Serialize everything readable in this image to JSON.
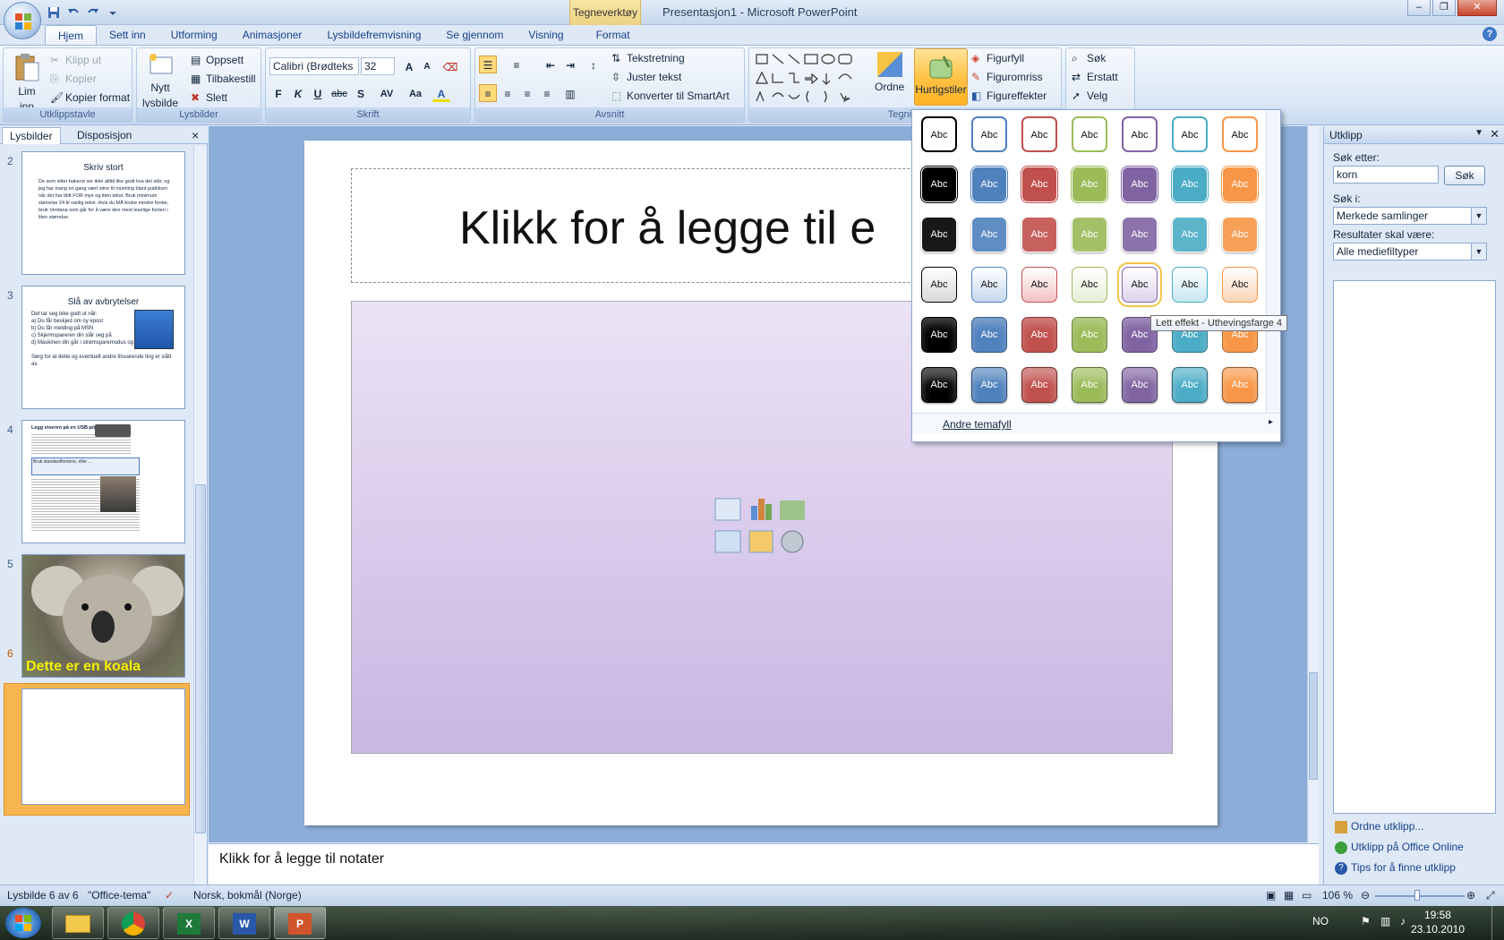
{
  "window": {
    "context_tab_title": "Tegneverktøy",
    "title": "Presentasjon1 - Microsoft PowerPoint"
  },
  "tabs": [
    {
      "label": "Hjem"
    },
    {
      "label": "Sett inn"
    },
    {
      "label": "Utforming"
    },
    {
      "label": "Animasjoner"
    },
    {
      "label": "Lysbildefremvisning"
    },
    {
      "label": "Se gjennom"
    },
    {
      "label": "Visning"
    },
    {
      "label": "Format"
    }
  ],
  "ribbon": {
    "clipboard": {
      "paste": "Lim",
      "paste2": "inn",
      "cut": "Klipp ut",
      "copy": "Kopier",
      "format_painter": "Kopier format",
      "group": "Utklippstavle"
    },
    "slides": {
      "new": "Nytt",
      "new2": "lysbilde",
      "layout": "Oppsett",
      "reset": "Tilbakestill",
      "delete": "Slett",
      "group": "Lysbilder"
    },
    "font": {
      "name": "Calibri (Brødteks",
      "size": "32",
      "group": "Skrift",
      "bold": "F",
      "italic": "K",
      "underline": "U",
      "strike": "abc",
      "shadow": "S",
      "spacing": "AV",
      "case": "Aa",
      "color": "A",
      "grow": "A",
      "shrink": "A"
    },
    "paragraph": {
      "text_direction": "Tekstretning",
      "align_text": "Juster tekst",
      "smartart": "Konverter til SmartArt",
      "group": "Avsnitt"
    },
    "drawing": {
      "arrange": "Ordne",
      "quick_styles": "Hurtigstiler",
      "shape_fill": "Figurfyll",
      "shape_outline": "Figuromriss",
      "shape_effects": "Figureffekter",
      "group": "Tegning"
    },
    "editing": {
      "find": "Søk",
      "replace": "Erstatt",
      "select": "Velg"
    }
  },
  "left_pane": {
    "tabs": [
      "Lysbilder",
      "Disposisjon"
    ],
    "close": "×",
    "slide2": {
      "num": "2",
      "title": "Skriv stort",
      "body": "De som sitter bakerst ser ikke alltid like godt hva det står, og jeg har mang en gang vært vitne til mumling blant publikum når det har blitt FOR mye og liten tekst. Bruk minimum størrelse 24 til vanlig tekst. Hvis du MÅ bruke mindre fonter, bruk Verdana som går for å være den mest leselige fonten i liten størrelse."
    },
    "slide3": {
      "num": "3",
      "title": "Slå av avbrytelser",
      "intro": "Det tar seg ikke godt ut når:",
      "items": [
        "a)  Du får beskjed om ny epost",
        "b)  Du får melding på MSN",
        "c)  Skjermspareren din slår seg på",
        "d)  Maskinen din går i strømsparemodus og slutter skjermen."
      ],
      "footer": "Sørg for at dette og eventuelt andre tilsvarende ting er slått av."
    },
    "slide4": {
      "num": "4",
      "title": "Legg viseren på en USB-pinne",
      "sub": "Bruk standardfontene, eller ..."
    },
    "slide5": {
      "num": "5",
      "caption": "Dette er en koala"
    },
    "slide6": {
      "num": "6"
    }
  },
  "slide": {
    "title_placeholder": "Klikk for å legge til e",
    "notes_placeholder": "Klikk for å legge til notater"
  },
  "gallery": {
    "swatch_label": "Abc",
    "colors": [
      "#000000",
      "#4f81bd",
      "#c0504d",
      "#9bbb59",
      "#8064a2",
      "#4bacc6",
      "#f79646"
    ],
    "light_fills": [
      "#d8d8d8",
      "#c6d9f1",
      "#f2c3c2",
      "#e6eed5",
      "#ddd3ec",
      "#c8e8f2",
      "#fbd5b5"
    ],
    "hovered": {
      "row": 4,
      "col": 5
    },
    "more_fills": "Andre temafyll",
    "tooltip": "Lett effekt - Uthevingsfarge 4"
  },
  "clip_pane": {
    "title": "Utklipp",
    "search_label": "Søk etter:",
    "search_value": "korn",
    "search_button": "Søk",
    "in_label": "Søk i:",
    "in_value": "Merkede samlinger",
    "results_label": "Resultater skal være:",
    "results_value": "Alle mediefiltyper",
    "links": [
      "Ordne utklipp...",
      "Utklipp på Office Online",
      "Tips for å finne utklipp"
    ]
  },
  "status": {
    "slide": "Lysbilde 6 av 6",
    "theme": "\"Office-tema\"",
    "language": "Norsk, bokmål (Norge)",
    "zoom": "106 %"
  },
  "taskbar": {
    "lang": "NO",
    "time": "19:58",
    "date": "23.10.2010"
  }
}
